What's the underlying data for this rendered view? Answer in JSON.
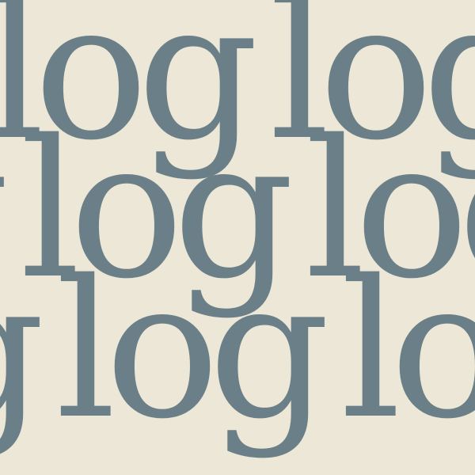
{
  "pattern": {
    "word": "log",
    "background_color": "#ece7d6",
    "text_color": "#6b7f88"
  }
}
